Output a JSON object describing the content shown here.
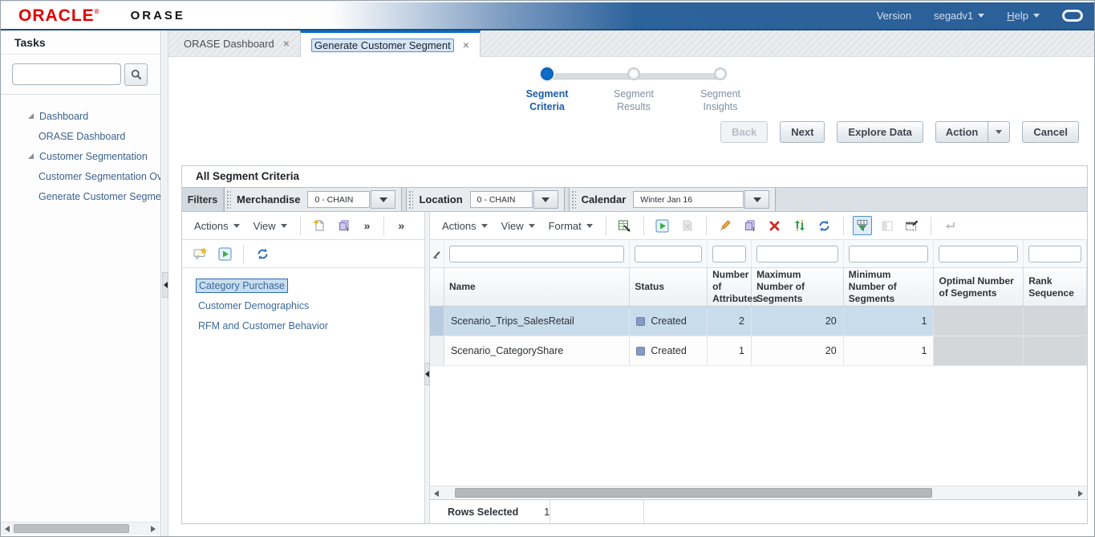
{
  "topbar": {
    "brand": "ORACLE",
    "brand_mark": "®",
    "app": "ORASE",
    "version": "Version",
    "user": "segadv1",
    "help": "Help"
  },
  "sidebar": {
    "title": "Tasks",
    "tree": [
      {
        "label": "Dashboard"
      },
      {
        "label": "ORASE Dashboard"
      },
      {
        "label": "Customer Segmentation"
      },
      {
        "label": "Customer Segmentation Ove"
      },
      {
        "label": "Generate Customer Segmen"
      }
    ]
  },
  "tabs": {
    "dashboard": "ORASE Dashboard",
    "generate": "Generate Customer Segment",
    "close": "×"
  },
  "wizard": {
    "steps": [
      {
        "label": "Segment Criteria"
      },
      {
        "label": "Segment Results"
      },
      {
        "label": "Segment Insights"
      }
    ]
  },
  "buttons": {
    "back": "Back",
    "next": "Next",
    "explore": "Explore Data",
    "action": "Action",
    "cancel": "Cancel"
  },
  "panel": {
    "title": "All Segment Criteria",
    "filters": {
      "label": "Filters",
      "merchandise_label": "Merchandise",
      "merchandise_value": "0 - CHAIN",
      "location_label": "Location",
      "location_value": "0 - CHAIN",
      "calendar_label": "Calendar",
      "calendar_value": "Winter Jan 16"
    },
    "left": {
      "actions_menu": "Actions",
      "view_menu": "View",
      "overflow": "»",
      "items": [
        {
          "label": "Category Purchase"
        },
        {
          "label": "Customer Demographics"
        },
        {
          "label": "RFM and Customer Behavior"
        }
      ]
    },
    "table": {
      "actions_menu": "Actions",
      "view_menu": "View",
      "format_menu": "Format",
      "columns": [
        "Name",
        "Status",
        "Number of Attributes",
        "Maximum Number of Segments",
        "Minimum Number of Segments",
        "Optimal Number of Segments",
        "Rank Sequence"
      ],
      "rows": [
        {
          "name": "Scenario_Trips_SalesRetail",
          "status": "Created",
          "attributes": "2",
          "max_segments": "20",
          "min_segments": "1"
        },
        {
          "name": "Scenario_CategoryShare",
          "status": "Created",
          "attributes": "1",
          "max_segments": "20",
          "min_segments": "1"
        }
      ],
      "footer_label": "Rows Selected",
      "footer_value": "1"
    }
  },
  "colors": {
    "accent_blue": "#0b6cc8",
    "topbar_blue": "#2d639c",
    "oracle_red": "#e00000",
    "selected_row": "#c9dcec"
  }
}
